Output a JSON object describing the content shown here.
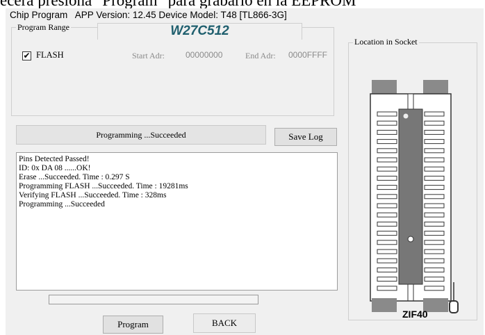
{
  "top_caption": "ecera presiona \"Program\" para grabarlo en la EEPROM",
  "window": {
    "title": "Chip Program",
    "app_version_label": "APP Version: 12.45",
    "device_model_label": "Device Model: T48 [TL866-3G]"
  },
  "program_range": {
    "legend": "Program Range",
    "chip_name": "W27C512",
    "flash_checked": true,
    "flash_label": "FLASH",
    "start_adr_label": "Start Adr:",
    "start_adr_value": "00000000",
    "end_adr_label": "End Adr:",
    "end_adr_value": "0000FFFF"
  },
  "status": {
    "text": "Programming ...Succeeded"
  },
  "buttons": {
    "save_log": "Save Log",
    "program": "Program",
    "back": "BACK"
  },
  "log_lines": [
    "Pins Detected Passed!",
    "ID: 0x DA 08 ......OK!",
    "Erase ...Succeeded. Time : 0.297 S",
    "Programming FLASH ...Succeeded. Time : 19281ms",
    "Verifying FLASH ...Succeeded. Time : 328ms",
    "Programming ...Succeeded"
  ],
  "progress": {
    "fraction": 0.0
  },
  "socket": {
    "legend": "Location in Socket",
    "zif_label": "ZIF40",
    "pins_per_side": 20
  },
  "colors": {
    "chip_name": "#1f5f6e",
    "background": "#f0f0f0",
    "chip_body": "#777777"
  }
}
